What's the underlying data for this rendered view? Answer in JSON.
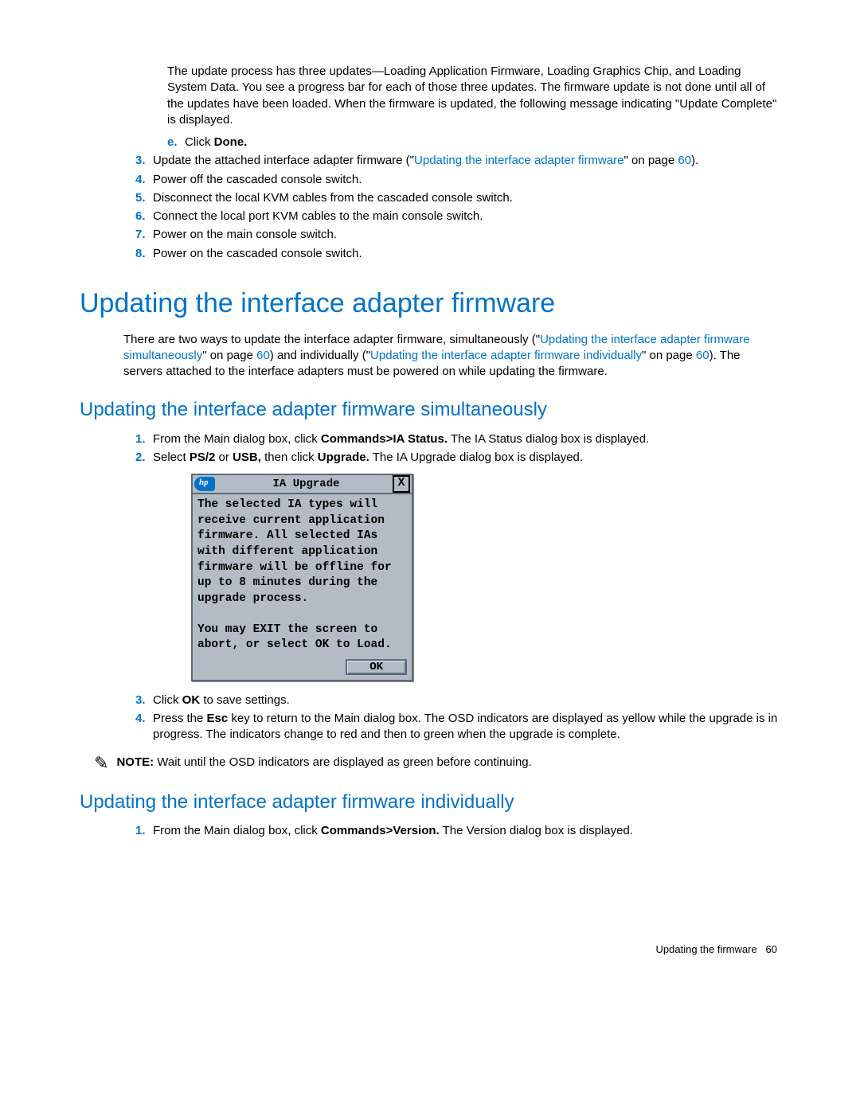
{
  "intro_para": "The update process has three updates—Loading Application Firmware, Loading Graphics Chip, and Loading System Data. You see a progress bar for each of those three updates. The firmware update is not done until all of the updates have been loaded. When the firmware is updated, the following message indicating \"Update Complete\" is displayed.",
  "step_e": {
    "letter": "e.",
    "prefix": "Click ",
    "bold": "Done."
  },
  "step_3": {
    "num": "3.",
    "pre": "Update the attached interface adapter firmware (\"",
    "link": "Updating the interface adapter firmware",
    "post": "\" on page ",
    "page": "60",
    "end": ")."
  },
  "step_4": {
    "num": "4.",
    "text": "Power off the cascaded console switch."
  },
  "step_5": {
    "num": "5.",
    "text": "Disconnect the local KVM cables from the cascaded console switch."
  },
  "step_6": {
    "num": "6.",
    "text": "Connect the local port KVM cables to the main console switch."
  },
  "step_7": {
    "num": "7.",
    "text": "Power on the main console switch."
  },
  "step_8": {
    "num": "8.",
    "text": "Power on the cascaded console switch."
  },
  "h1": "Updating the interface adapter firmware",
  "h1_para": {
    "p1": "There are two ways to update the interface adapter firmware, simultaneously (\"",
    "l1": "Updating the interface adapter firmware simultaneously",
    "p2": "\" on page ",
    "pg1": "60",
    "p3": ") and individually (\"",
    "l2": "Updating the interface adapter firmware individually",
    "p4": "\" on page ",
    "pg2": "60",
    "p5": "). The servers attached to the interface adapters must be powered on while updating the firmware."
  },
  "h2a": "Updating the interface adapter firmware simultaneously",
  "a_step_1": {
    "num": "1.",
    "pre": "From the Main dialog box, click ",
    "bold": "Commands>IA Status.",
    "post": " The IA Status dialog box is displayed."
  },
  "a_step_2": {
    "num": "2.",
    "pre": "Select ",
    "bold1": "PS/2",
    "mid1": " or ",
    "bold2": "USB,",
    "mid2": " then click ",
    "bold3": "Upgrade.",
    "post": " The IA Upgrade dialog box is displayed."
  },
  "dialog": {
    "title": "IA Upgrade",
    "close": "X",
    "body": "The selected IA types will\nreceive current application\nfirmware. All selected IAs\nwith different application\nfirmware will be offline for\nup to 8 minutes during the\nupgrade process.\n\nYou may EXIT the screen to\nabort, or select OK to Load.",
    "ok": "OK"
  },
  "a_step_3": {
    "num": "3.",
    "pre": "Click ",
    "bold": "OK",
    "post": " to save settings."
  },
  "a_step_4": {
    "num": "4.",
    "pre": "Press the ",
    "bold": "Esc",
    "post": " key to return to the Main dialog box. The OSD indicators are displayed as yellow while the upgrade is in progress. The indicators change to red and then to green when the upgrade is complete."
  },
  "note": {
    "label": "NOTE:",
    "text": "  Wait until the OSD indicators are displayed as green before continuing."
  },
  "h2b": "Updating the interface adapter firmware individually",
  "b_step_1": {
    "num": "1.",
    "pre": "From the Main dialog box, click ",
    "bold": "Commands>Version.",
    "post": " The Version dialog box is displayed."
  },
  "footer": {
    "text": "Updating the firmware",
    "page": "60"
  }
}
